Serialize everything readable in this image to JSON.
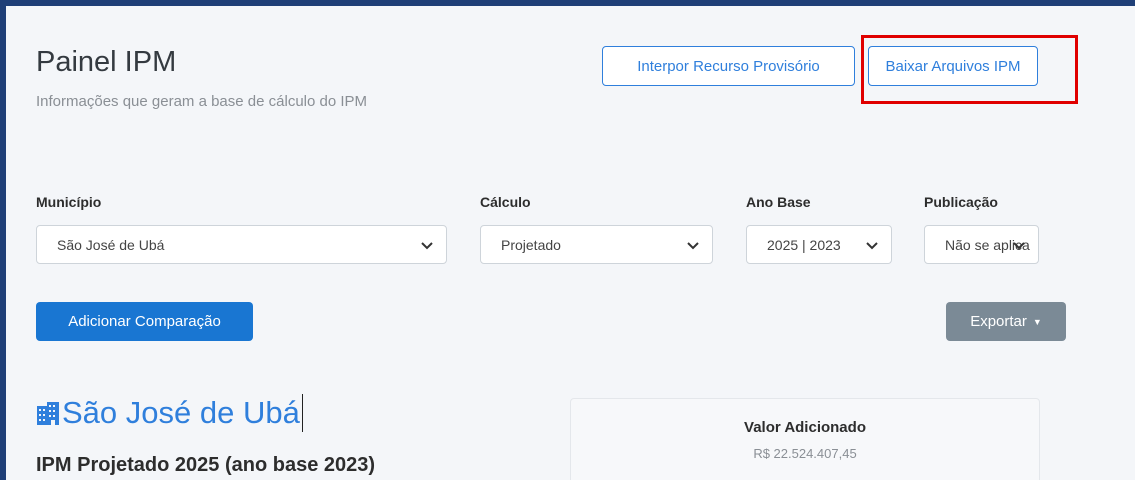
{
  "header": {
    "title": "Painel IPM",
    "subtitle": "Informações que geram a base de cálculo do IPM"
  },
  "actions": {
    "interpor_label": "Interpor Recurso Provisório",
    "baixar_label": "Baixar Arquivos IPM",
    "highlight_color": "#e00000"
  },
  "filters": {
    "municipio": {
      "label": "Município",
      "value": "São José de Ubá"
    },
    "calculo": {
      "label": "Cálculo",
      "value": "Projetado"
    },
    "ano_base": {
      "label": "Ano Base",
      "value": "2025 | 2023"
    },
    "publicacao": {
      "label": "Publicação",
      "value": "Não se aplica"
    }
  },
  "toolbar": {
    "add_comparison_label": "Adicionar Comparação",
    "export_label": "Exportar"
  },
  "result": {
    "municipality_name": "São José de Ubá",
    "ipm_heading": "IPM Projetado 2025 (ano base 2023)",
    "card": {
      "title": "Valor Adicionado",
      "value": "R$ 22.524.407,45"
    }
  },
  "colors": {
    "primary": "#1976d2",
    "accent_link": "#2f7fdc",
    "secondary": "#7b8a96",
    "frame_border": "#1f3f77"
  },
  "icons": {
    "building": "building-icon",
    "chevron": "chevron-down-icon",
    "caret": "caret-down-icon"
  }
}
